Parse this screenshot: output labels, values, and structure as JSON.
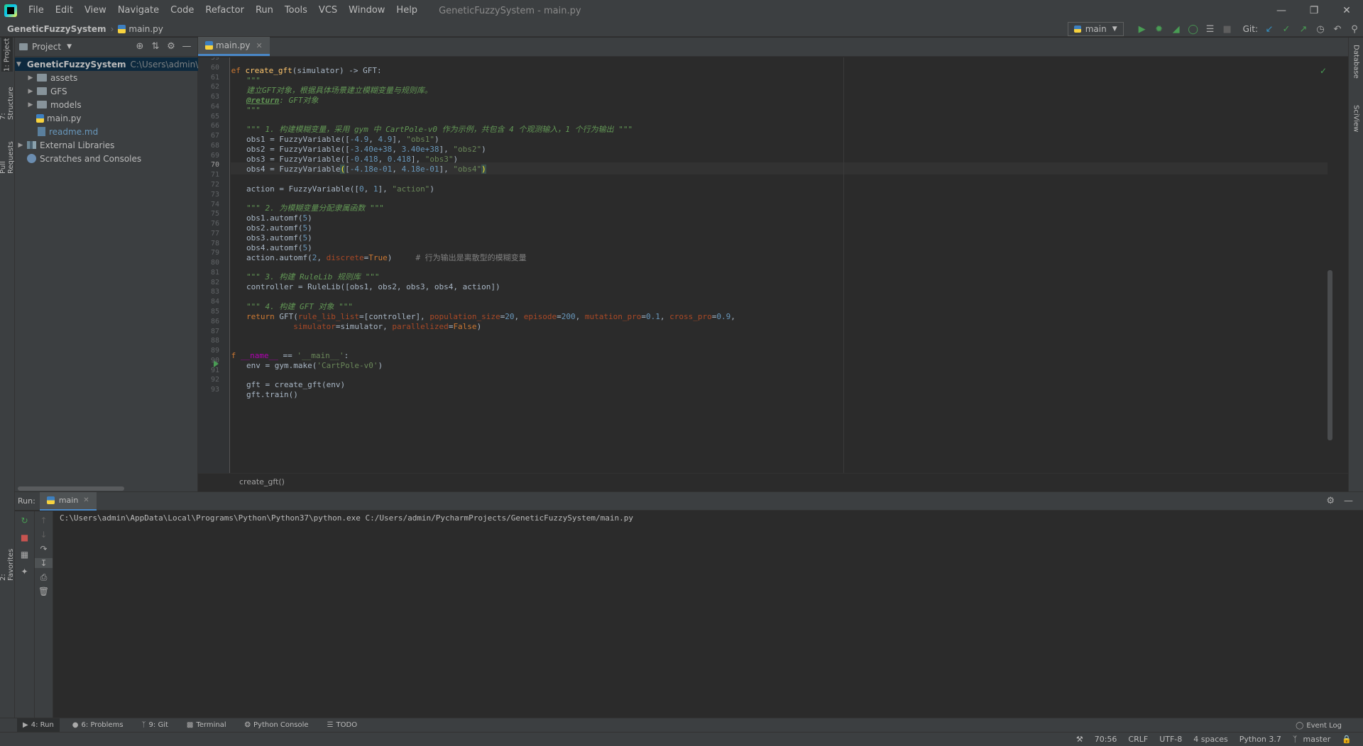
{
  "menubar": {
    "items": [
      "File",
      "Edit",
      "View",
      "Navigate",
      "Code",
      "Refactor",
      "Run",
      "Tools",
      "VCS",
      "Window",
      "Help"
    ],
    "window_title": "GeneticFuzzySystem - main.py"
  },
  "navbar": {
    "project": "GeneticFuzzySystem",
    "file": "main.py",
    "run_config": "main",
    "git_label": "Git:"
  },
  "left_stripe": {
    "project": "1: Project",
    "structure": "7: Structure",
    "pull_requests": "Pull Requests",
    "favorites": "2: Favorites"
  },
  "right_stripe": {
    "database": "Database",
    "sciview": "SciView"
  },
  "project_panel": {
    "title": "Project",
    "tree": [
      {
        "label": "GeneticFuzzySystem",
        "hint": "C:\\Users\\admin\\PycharmProjects\\GeneticFuzzySystem"
      },
      {
        "label": "assets"
      },
      {
        "label": "GFS"
      },
      {
        "label": "models"
      },
      {
        "label": "main.py"
      },
      {
        "label": "readme.md"
      },
      {
        "label": "External Libraries"
      },
      {
        "label": "Scratches and Consoles"
      }
    ]
  },
  "editor": {
    "tab": "main.py",
    "line_numbers": [
      "59",
      "60",
      "61",
      "62",
      "63",
      "64",
      "65",
      "66",
      "67",
      "68",
      "69",
      "70",
      "71",
      "72",
      "73",
      "74",
      "75",
      "76",
      "77",
      "78",
      "79",
      "80",
      "81",
      "82",
      "83",
      "84",
      "85",
      "86",
      "87",
      "88",
      "89",
      "90",
      "91",
      "92",
      "93"
    ],
    "current_line": "70",
    "code": {
      "l60_def": "def",
      "l60_name": "create_gft",
      "l60_rest": "(simulator) -> GFT:",
      "l61": "\"\"\"",
      "l62": "建立GFT对象，根据具体场景建立模糊变量与规则库。",
      "l63_tag": "@return",
      "l63_rest": ": GFT对象",
      "l64": "\"\"\"",
      "l66": "\"\"\" 1. 构建模糊变量，采用 gym 中 CartPole-v0 作为示例，共包含 4 个观测输入，1 个行为输出 \"\"\"",
      "l67": [
        "obs1 = FuzzyVariable([",
        "-4.9",
        ", ",
        "4.9",
        "], ",
        "\"obs1\"",
        ")"
      ],
      "l68": [
        "obs2 = FuzzyVariable([",
        "-3.40e+38",
        ", ",
        "3.40e+38",
        "], ",
        "\"obs2\"",
        ")"
      ],
      "l69": [
        "obs3 = FuzzyVariable([",
        "-0.418",
        ", ",
        "0.418",
        "], ",
        "\"obs3\"",
        ")"
      ],
      "l70": [
        "obs4 = FuzzyVariable",
        "(",
        "[",
        "-4.18e-01",
        ", ",
        "4.18e-01",
        "], ",
        "\"obs4\"",
        ")"
      ],
      "l72": [
        "action = FuzzyVariable([",
        "0",
        ", ",
        "1",
        "], ",
        "\"action\"",
        ")"
      ],
      "l74": "\"\"\" 2. 为模糊变量分配隶属函数 \"\"\"",
      "l75": [
        "obs1.automf(",
        "5",
        ")"
      ],
      "l76": [
        "obs2.automf(",
        "5",
        ")"
      ],
      "l77": [
        "obs3.automf(",
        "5",
        ")"
      ],
      "l78": [
        "obs4.automf(",
        "5",
        ")"
      ],
      "l79": [
        "action.automf(",
        "2",
        ", ",
        "discrete",
        "=",
        "True",
        ")",
        "     # 行为输出是离散型的模糊变量"
      ],
      "l81": "\"\"\" 3. 构建 RuleLib 规则库 \"\"\"",
      "l82": "controller = RuleLib([obs1, obs2, obs3, obs4, action])",
      "l84": "\"\"\" 4. 构建 GFT 对象 \"\"\"",
      "l85": [
        "return",
        " GFT(",
        "rule_lib_list",
        "=[controller], ",
        "population_size",
        "=",
        "20",
        ", ",
        "episode",
        "=",
        "200",
        ", ",
        "mutation_pro",
        "=",
        "0.1",
        ", ",
        "cross_pro",
        "=",
        "0.9",
        ","
      ],
      "l86": [
        "          ",
        "simulator",
        "=simulator, ",
        "parallelized",
        "=",
        "False",
        ")"
      ],
      "l89": [
        "if",
        " ",
        "__name__",
        " == ",
        "'__main__'",
        ":"
      ],
      "l90": [
        "env = gym.make(",
        "'CartPole-v0'",
        ")"
      ],
      "l92": "gft = create_gft(env)",
      "l93": "gft.train()"
    },
    "breadcrumb": "create_gft()"
  },
  "run_panel": {
    "label": "Run:",
    "tab": "main",
    "console_line": "C:\\Users\\admin\\AppData\\Local\\Programs\\Python\\Python37\\python.exe C:/Users/admin/PycharmProjects/GeneticFuzzySystem/main.py"
  },
  "tool_tabs": {
    "run": "4: Run",
    "problems": "6: Problems",
    "git": "9: Git",
    "terminal": "Terminal",
    "python_console": "Python Console",
    "todo": "TODO",
    "event_log": "Event Log"
  },
  "status_bar": {
    "position": "70:56",
    "line_sep": "CRLF",
    "encoding": "UTF-8",
    "indent": "4 spaces",
    "interpreter": "Python 3.7",
    "branch": "master"
  },
  "colors": {
    "background": "#2b2b2b",
    "panel": "#3c3f41",
    "accent": "#4a88c7",
    "keyword": "#cc7832",
    "string": "#6a8759",
    "number": "#6897bb",
    "function": "#ffc66d"
  }
}
